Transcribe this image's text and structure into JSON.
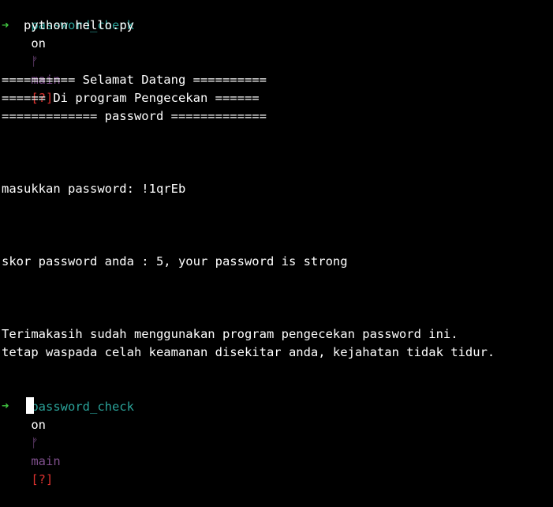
{
  "prompt_top": {
    "dir": "password_check",
    "on": "on",
    "branch_icon": "git-branch-icon",
    "branch_glyph": "ᚠ",
    "branch": "main",
    "status": "[?]"
  },
  "command_line": {
    "arrow": "➜",
    "command": "python hello.py"
  },
  "banner": [
    "========== Selamat Datang ==========",
    "====== Di program Pengecekan ======",
    "============= password ============="
  ],
  "input_line": "masukkan password: !1qrEb",
  "result_line": "skor password anda : 5, your password is strong",
  "closing": [
    "Terimakasih sudah menggunakan program pengecekan password ini.",
    "tetap waspada celah keamanan disekitar anda, kejahatan tidak tidur."
  ],
  "prompt_bottom": {
    "dir": "password_check",
    "on": "on",
    "branch_icon": "git-branch-icon",
    "branch_glyph": "ᚠ",
    "branch": "main",
    "status": "[?]",
    "arrow": "➜"
  },
  "colors": {
    "background": "#000000",
    "directory": "#2aa198",
    "branch": "#7e4f8c",
    "status": "#dc322f",
    "arrow": "#3fc13f",
    "text": "#ffffff"
  }
}
